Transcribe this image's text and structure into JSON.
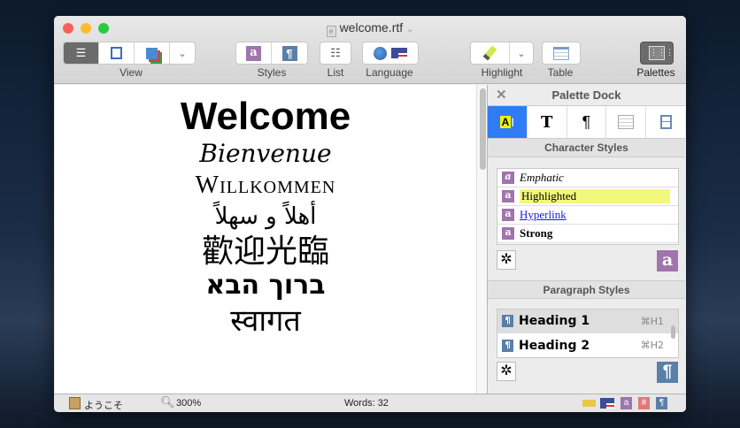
{
  "window": {
    "title": "welcome.rtf"
  },
  "toolbar": {
    "view_label": "View",
    "styles_label": "Styles",
    "list_label": "List",
    "language_label": "Language",
    "highlight_label": "Highlight",
    "table_label": "Table",
    "palettes_label": "Palettes"
  },
  "document": {
    "lines": [
      "Welcome",
      "Bienvenue",
      "Willkommen",
      "أهلاً و سهلاً",
      "歡迎光臨",
      "ברוך הבא",
      "स्वागत"
    ]
  },
  "palette": {
    "title": "Palette Dock",
    "character_styles_title": "Character Styles",
    "character_styles": [
      "Emphatic",
      "Highlighted",
      "Hyperlink",
      "Strong"
    ],
    "paragraph_styles_title": "Paragraph Styles",
    "paragraph_styles": [
      {
        "name": "Heading 1",
        "shortcut": "⌘H1"
      },
      {
        "name": "Heading 2",
        "shortcut": "⌘H2"
      }
    ]
  },
  "status": {
    "doc_name": "ようこそ",
    "zoom": "300%",
    "words": "Words: 32"
  },
  "colors": {
    "highlight": "#f2f97a",
    "accent": "#2f7cf6",
    "char_style": "#a074ac",
    "para_style": "#5a7fa8"
  }
}
